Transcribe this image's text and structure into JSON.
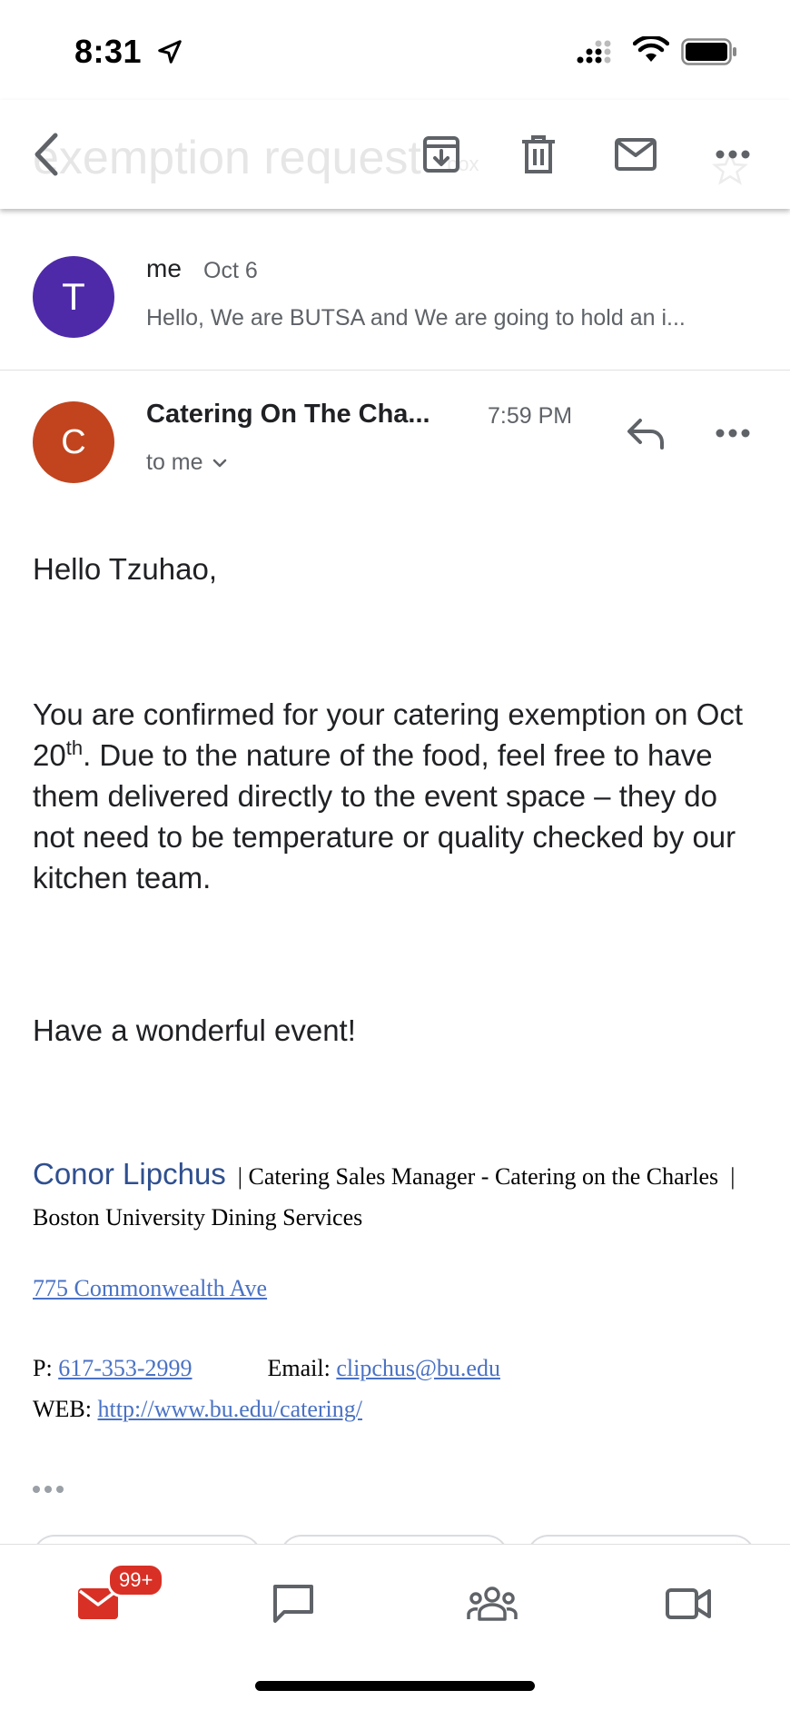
{
  "status_bar": {
    "time": "8:31"
  },
  "toolbar": {
    "ghost_title": "exemption request",
    "ghost_label": "box"
  },
  "thread": {
    "collapsed_message": {
      "avatar_letter": "T",
      "avatar_color": "#4e2aa8",
      "sender": "me",
      "date": "Oct 6",
      "snippet": "Hello, We are BUTSA and We are going to hold an i..."
    },
    "open_message": {
      "avatar_letter": "C",
      "avatar_color": "#c1441f",
      "sender": "Catering On The Cha...",
      "time": "7:59 PM",
      "recipient": "to me",
      "body": {
        "greeting": "Hello Tzuhao,",
        "para_part1": "You are confirmed for your catering exemption on Oct 20",
        "para_sup": "th",
        "para_part2": ". Due to the nature of the food, feel free to have them delivered directly to the event space – they do not need to be temperature or quality checked by our kitchen team.",
        "closing": "Have a wonderful event!"
      },
      "signature": {
        "name": "Conor Lipchus",
        "title_line": "| Catering Sales Manager - Catering on the Charles",
        "org_line": "| Boston University Dining Services",
        "address": "775 Commonwealth Ave",
        "phone_label": "P:",
        "phone": "617-353-2999",
        "email_label": "Email:",
        "email": "clipchus@bu.edu",
        "web_label": "WEB:",
        "web": "http://www.bu.edu/catering/"
      }
    }
  },
  "bottom_nav": {
    "mail_badge": "99+",
    "items": [
      "mail",
      "chat",
      "spaces",
      "meet"
    ]
  },
  "colors": {
    "accent_red": "#d93025",
    "link_blue": "#4a72c4"
  }
}
